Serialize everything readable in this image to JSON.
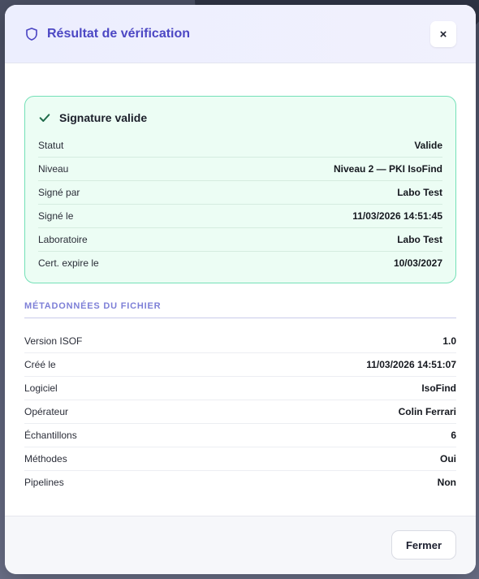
{
  "header": {
    "title": "Résultat de vérification",
    "close_label": "×",
    "icon": "shield-icon"
  },
  "signature": {
    "title": "Signature valide",
    "icon": "check-icon",
    "rows": [
      {
        "label": "Statut",
        "value": "Valide"
      },
      {
        "label": "Niveau",
        "value": "Niveau 2 — PKI IsoFind"
      },
      {
        "label": "Signé par",
        "value": "Labo Test"
      },
      {
        "label": "Signé le",
        "value": "11/03/2026 14:51:45"
      },
      {
        "label": "Laboratoire",
        "value": "Labo Test"
      },
      {
        "label": "Cert. expire le",
        "value": "10/03/2027"
      }
    ]
  },
  "metadata": {
    "section_title": "MÉTADONNÉES DU FICHIER",
    "rows": [
      {
        "label": "Version ISOF",
        "value": "1.0"
      },
      {
        "label": "Créé le",
        "value": "11/03/2026 14:51:07"
      },
      {
        "label": "Logiciel",
        "value": "IsoFind"
      },
      {
        "label": "Opérateur",
        "value": "Colin Ferrari"
      },
      {
        "label": "Échantillons",
        "value": "6"
      },
      {
        "label": "Méthodes",
        "value": "Oui"
      },
      {
        "label": "Pipelines",
        "value": "Non"
      }
    ]
  },
  "footer": {
    "close_button_label": "Fermer"
  },
  "colors": {
    "accent": "#4c47c4",
    "success_border": "#74e0b7",
    "success_bg": "#ecfdf4",
    "check": "#1f6b4a"
  }
}
